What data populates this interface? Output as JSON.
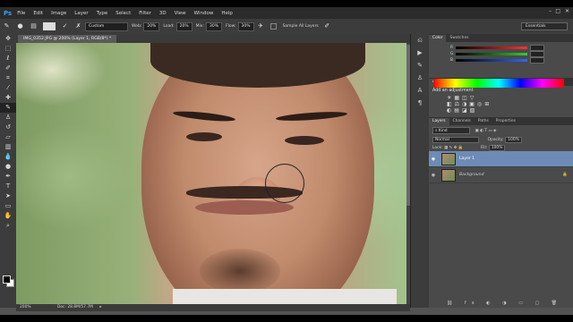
{
  "app": {
    "logo": "Ps"
  },
  "menu": [
    "File",
    "Edit",
    "Image",
    "Layer",
    "Type",
    "Select",
    "Filter",
    "3D",
    "View",
    "Window",
    "Help"
  ],
  "options": {
    "mode": "Custom",
    "web_label": "Web:",
    "web_value": "20%",
    "load_label": "Load:",
    "load_value": "20%",
    "mix_label": "Mix:",
    "mix_value": "30%",
    "flow_label": "Flow:",
    "flow_value": "30%",
    "sample_label": "Sample All Layers",
    "workspace": "Essentials"
  },
  "document": {
    "title": "IMG_0352.JPG @ 200% (Layer 1, RGB/8*) *",
    "zoom": "200%",
    "doc_size": "Doc: 28.8M/57.7M"
  },
  "color_panel": {
    "tabs": [
      "Color",
      "Swatches"
    ],
    "channels": [
      "R",
      "G",
      "B"
    ],
    "colors": {
      "r": "#ff3b3b",
      "g": "#35c335",
      "b": "#3b6bff",
      "fg": "#000000",
      "bg": "#ffffff"
    }
  },
  "adjustments": {
    "tabs": [
      "Adjustments",
      "Styles"
    ],
    "heading": "Add an adjustment"
  },
  "layers_panel": {
    "tabs": [
      "Layers",
      "Channels",
      "Paths",
      "Properties"
    ],
    "filter": "Kind",
    "blend_mode": "Normal",
    "opacity_label": "Opacity:",
    "opacity_value": "100%",
    "lock_label": "Lock:",
    "fill_label": "Fill:",
    "fill_value": "100%",
    "layers": [
      {
        "name": "Layer 1",
        "selected": true
      },
      {
        "name": "Background",
        "selected": false
      }
    ]
  }
}
